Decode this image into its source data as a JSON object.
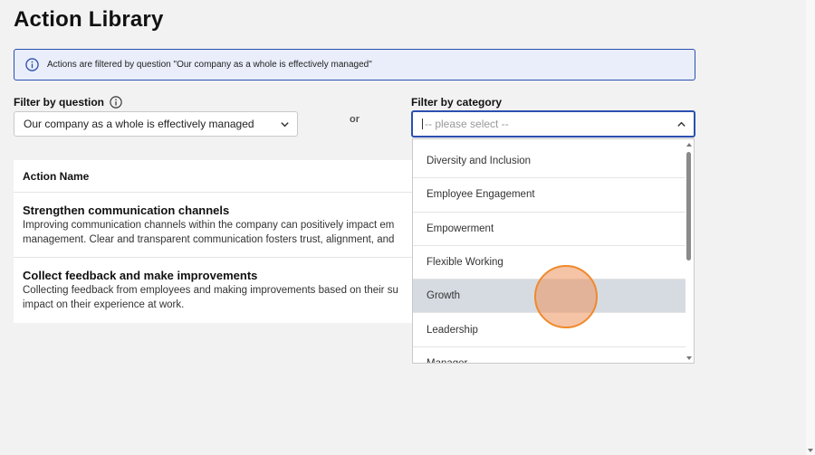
{
  "page": {
    "title": "Action Library"
  },
  "info": {
    "text": "Actions are filtered by question \"Our company as a whole is effectively managed\"",
    "icon": "info-icon"
  },
  "filters": {
    "question_label": "Filter by question",
    "question_value": "Our company as a whole is effectively managed",
    "or_text": "or",
    "category_label": "Filter by category",
    "category_placeholder": "-- please select --"
  },
  "dropdown": {
    "options": [
      {
        "label": "Diversity and Inclusion"
      },
      {
        "label": "Employee Engagement"
      },
      {
        "label": "Empowerment"
      },
      {
        "label": "Flexible Working"
      },
      {
        "label": "Growth"
      },
      {
        "label": "Leadership"
      },
      {
        "label": "Manager"
      }
    ],
    "highlighted": "Growth"
  },
  "table": {
    "header": "Action Name",
    "rows": [
      {
        "name": "Strengthen communication channels",
        "desc_line1": "Improving communication channels within the company can positively impact em",
        "desc_line2": "management. Clear and transparent communication fosters trust, alignment, and"
      },
      {
        "name": "Collect feedback and make improvements",
        "desc_line1": "Collecting feedback from employees and making improvements based on their su",
        "desc_line2": "impact on their experience at work."
      }
    ]
  },
  "colors": {
    "accent": "#2c4fb0",
    "highlight": "#d6dbe2",
    "cursor": "#ef8a2c"
  }
}
